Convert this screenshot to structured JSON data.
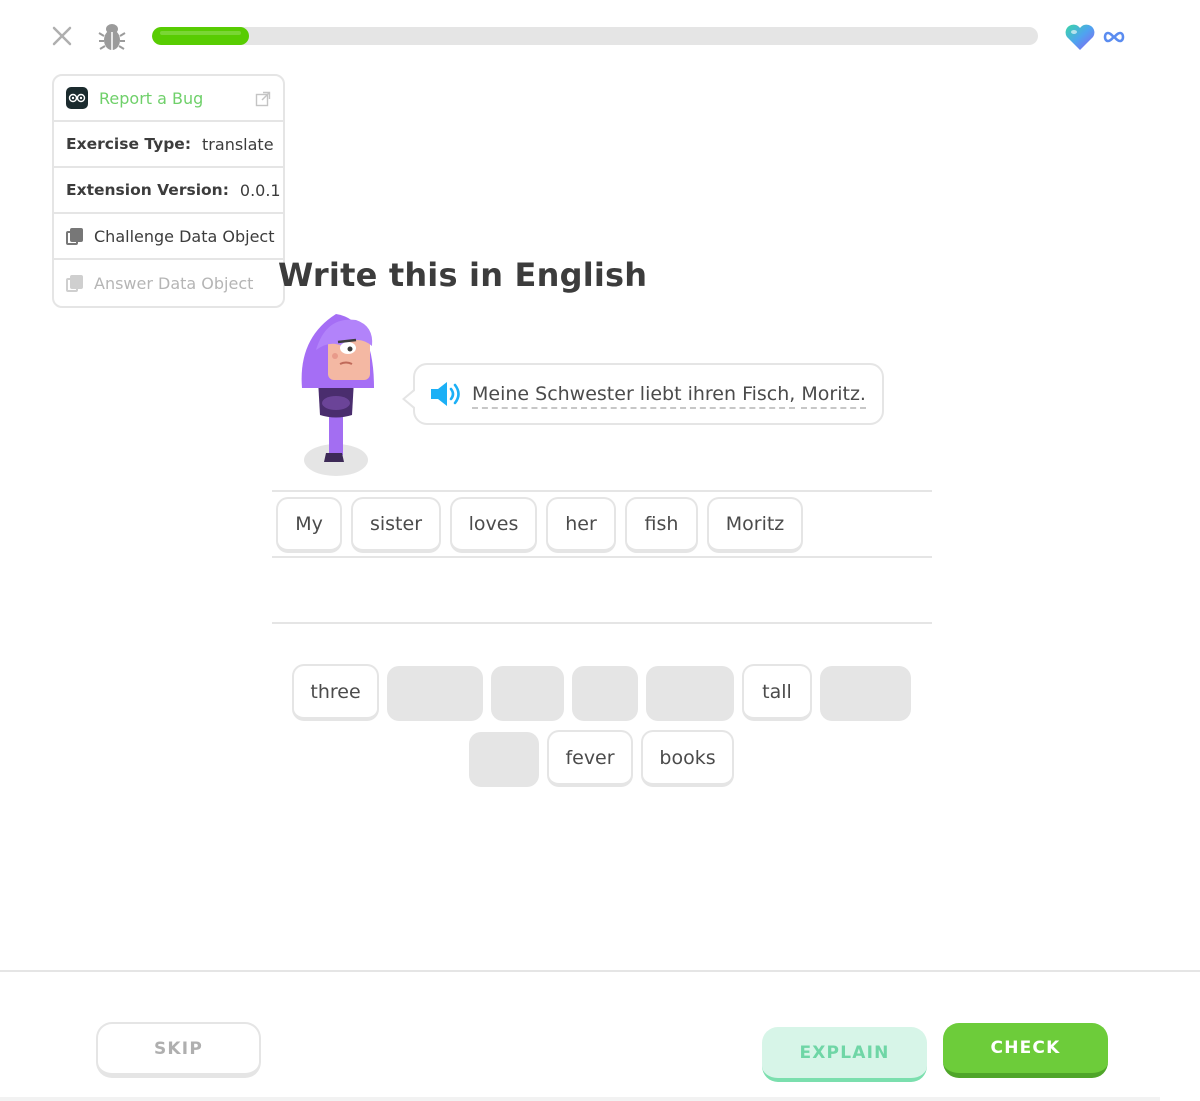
{
  "top_bar": {
    "close_icon": "close-icon",
    "bug_icon": "bug-icon",
    "progress_fraction": 0.11,
    "hearts_icon": "heart-icon",
    "hearts_count_icon": "infinity-icon",
    "colors": {
      "progress": "#58cc02",
      "track": "#e5e5e5"
    }
  },
  "debug_panel": {
    "report_label": "Report a Bug",
    "report_icon": "external-link-icon",
    "exercise_type_label": "Exercise Type:",
    "exercise_type_value": "translate",
    "extension_version_label": "Extension Version:",
    "extension_version_value": "0.0.1",
    "challenge_data_label": "Challenge Data Object",
    "answer_data_label": "Answer Data Object"
  },
  "challenge": {
    "title": "Write this in English",
    "sentence_words": [
      "Meine Schwester liebt ihren Fisch,",
      "Moritz."
    ],
    "speaker_icon": "speaker-icon"
  },
  "answer_tiles": [
    "My",
    "sister",
    "loves",
    "her",
    "fish",
    "Moritz"
  ],
  "word_bank": {
    "row1": [
      {
        "label": "three",
        "used": false
      },
      {
        "label": "",
        "used": true
      },
      {
        "label": "",
        "used": true
      },
      {
        "label": "",
        "used": true
      },
      {
        "label": "",
        "used": true
      },
      {
        "label": "tall",
        "used": false
      },
      {
        "label": "",
        "used": true
      }
    ],
    "row2": [
      {
        "label": "",
        "used": true
      },
      {
        "label": "fever",
        "used": false
      },
      {
        "label": "books",
        "used": false
      }
    ]
  },
  "footer": {
    "skip_label": "SKIP",
    "explain_label": "EXPLAIN",
    "check_label": "CHECK",
    "colors": {
      "check": "#6dcc3a",
      "explain": "#d7f5e8"
    }
  }
}
